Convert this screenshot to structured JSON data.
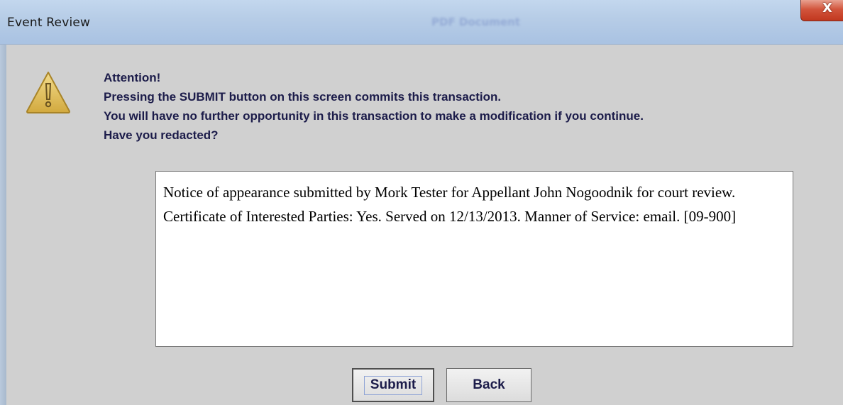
{
  "window": {
    "title": "Event Review",
    "background_title": "PDF Document",
    "close_glyph": "X"
  },
  "icons": {
    "warning": "warning-icon",
    "close": "close-icon"
  },
  "message": {
    "line1": "Attention!",
    "line2": "Pressing the SUBMIT button on this screen commits this transaction.",
    "line3": "You will have no further opportunity in this transaction to make a modification if you continue.",
    "line4": "Have you redacted?"
  },
  "docket_text": "Notice of appearance submitted by Mork Tester for Appellant John Nogoodnik for court review. Certificate of Interested Parties: Yes. Served on 12/13/2013. Manner of Service: email. [09-900]",
  "buttons": {
    "submit": "Submit",
    "back": "Back"
  },
  "colors": {
    "dialog_bg": "#d0d0d0",
    "text": "#1c1c4a",
    "close_button": "#c1371f",
    "warning_fill": "#e2c060"
  }
}
